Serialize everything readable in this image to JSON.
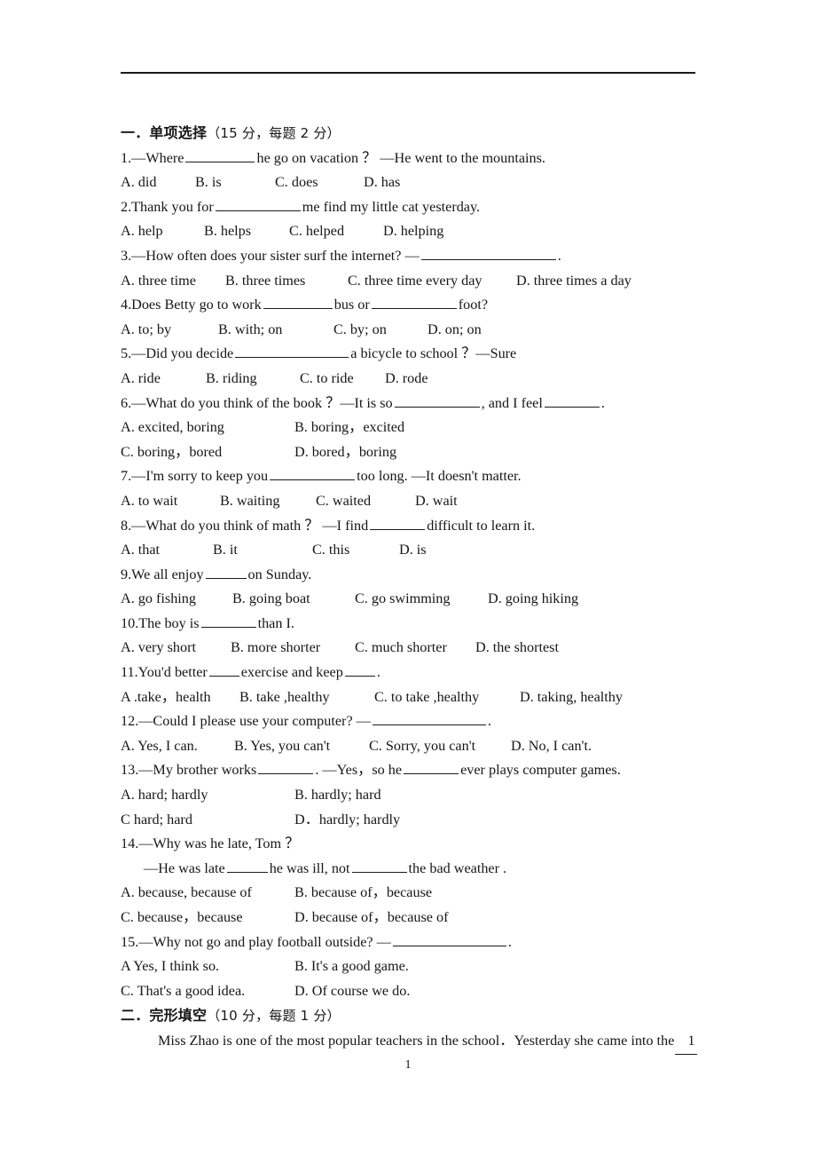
{
  "document": {
    "page_number": "1"
  },
  "section1": {
    "index": "一．",
    "title": "单项选择",
    "marks": "（15 分，每题 2 分）",
    "questions": [
      {
        "stem_before": "1.—Where",
        "blank": "l",
        "stem_after": "he go on vacation ？   —He went to the mountains.",
        "options": [
          "A. did",
          "B. is",
          "C. does",
          "D. has"
        ]
      },
      {
        "stem_before": "2.Thank you for",
        "blank": "xl",
        "stem_after": "me find my little cat yesterday.",
        "options": [
          "A. help",
          "B. helps",
          "C. helped",
          "D. helping"
        ]
      },
      {
        "stem_before": "3.—How often does your sister surf the internet?    —",
        "blank": "xxl",
        "stem_after": ".",
        "options": [
          "A. three time",
          "B. three times",
          "C. three time every day",
          "D. three times a day"
        ]
      },
      {
        "stem_before": "4.Does Betty go to work",
        "blank": "l",
        "stem_mid": "bus or",
        "blank2": "xl",
        "stem_after": "foot?",
        "options": [
          "A. to; by",
          "B. with; on",
          "C. by; on",
          "D. on; on"
        ]
      },
      {
        "stem_before": "5.—Did you decide",
        "blank": "xxl",
        "stem_after": "a bicycle to school ？—Sure",
        "options": [
          "A. ride",
          "B. riding",
          "C. to ride",
          "D. rode"
        ]
      },
      {
        "stem_before": "6.—What do you think of the book ？—It is so",
        "blank": "xl",
        "stem_mid": ", and I feel",
        "blank2": "m",
        "stem_after": ".",
        "options": [
          "A. excited, boring",
          "B. boring，excited",
          "C. boring，bored",
          "D. bored，boring"
        ],
        "two_line_options": true
      },
      {
        "stem_before": "7.—I'm sorry to keep you",
        "blank": "xl",
        "stem_after": "too long.   —It doesn't matter.",
        "options": [
          "A. to wait",
          "B. waiting",
          "C. waited",
          "D. wait"
        ]
      },
      {
        "stem_before": "8.—What do you think of math ？   —I find",
        "blank": "m",
        "stem_after": "difficult to learn it.",
        "options": [
          "A. that",
          "B. it",
          "C. this",
          "D. is"
        ]
      },
      {
        "stem_before": "9.We all enjoy",
        "blank": "s",
        "stem_after": "on Sunday.",
        "options": [
          "A. go fishing",
          "B. going boat",
          "C. go swimming",
          "D. going hiking"
        ]
      },
      {
        "stem_before": "10.The boy is",
        "blank": "m",
        "stem_after": "than I.",
        "options": [
          "A. very short",
          "B. more shorter",
          "C. much shorter",
          "D. the shortest"
        ]
      },
      {
        "stem_before": "11.You'd better",
        "blank": "xs",
        "stem_mid": "exercise and keep",
        "blank2": "xs",
        "stem_after": ".",
        "options": [
          "A .take，health",
          "B. take ,healthy",
          "C. to take ,healthy",
          "D. taking, healthy"
        ]
      },
      {
        "stem_before": "12.—Could I please use your computer?   —",
        "blank": "xxl",
        "stem_after": ".",
        "options": [
          "A. Yes, I can.",
          "B. Yes, you can't",
          "C. Sorry, you can't",
          "D. No, I can't."
        ]
      },
      {
        "stem_before": "13.—My  brother works",
        "blank": "m",
        "stem_mid": ".   —Yes，so he",
        "blank2": "m",
        "stem_after": "ever plays computer games.",
        "options": [
          "A. hard; hardly",
          "B. hardly; hard",
          "C  hard; hard",
          "D．hardly; hardly"
        ],
        "two_line_options": true
      },
      {
        "stem_before": "14.—Why was he late, Tom ？",
        "stem_line2_before": "—He was late",
        "blank": "s",
        "stem_line2_mid": "he was ill, not",
        "blank2": "m",
        "stem_after": "the bad weather .",
        "options": [
          "A. because, because of",
          "B. because of，because",
          "C. because，because",
          "D. because of，because of"
        ],
        "two_line_options": true
      },
      {
        "stem_before": "15.—Why not go and play football outside?   —",
        "blank": "xxl",
        "stem_after": ".",
        "options": [
          "A Yes, I think so.",
          "B. It's a good game.",
          "C. That's a good idea.",
          "D. Of course we do."
        ],
        "two_line_options": true
      }
    ]
  },
  "section2": {
    "index": "二．",
    "title": "完形填空",
    "marks": "（10 分，每题 1 分）",
    "passage_line1": "Miss Zhao is one of the most popular teachers in the school．Yesterday she came into the",
    "passage_blank1": "1"
  }
}
